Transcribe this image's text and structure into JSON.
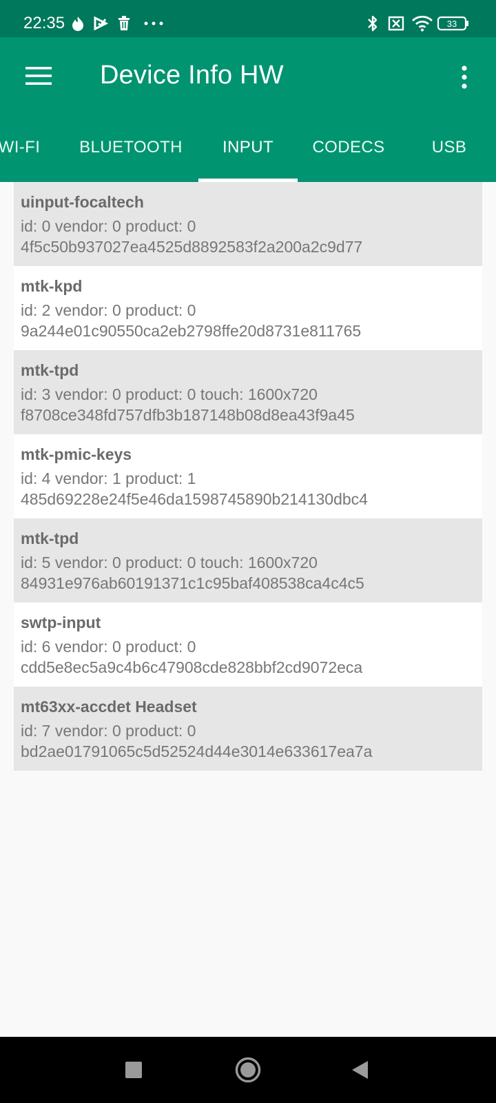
{
  "status_bar": {
    "time": "22:35",
    "battery_level": "33",
    "icons": [
      "fire-icon",
      "play-check-icon",
      "trash-icon",
      "more-dots-icon",
      "bluetooth-icon",
      "no-sim-icon",
      "wifi-icon",
      "battery-icon"
    ]
  },
  "app_bar": {
    "title": "Device Info HW",
    "menu_icon": "hamburger-menu-icon",
    "overflow_icon": "vertical-dots-icon"
  },
  "tabs": [
    {
      "label": "WI-FI"
    },
    {
      "label": "BLUETOOTH"
    },
    {
      "label": "INPUT"
    },
    {
      "label": "CODECS"
    },
    {
      "label": "USB"
    }
  ],
  "active_tab": "INPUT",
  "devices": [
    {
      "name": "uinput-focaltech",
      "detail": "id: 0 vendor: 0 product: 0",
      "hash": "4f5c50b937027ea4525d8892583f2a200a2c9d77"
    },
    {
      "name": "mtk-kpd",
      "detail": "id: 2 vendor: 0 product: 0",
      "hash": "9a244e01c90550ca2eb2798ffe20d8731e811765"
    },
    {
      "name": "mtk-tpd",
      "detail": "id: 3 vendor: 0 product: 0 touch: 1600x720",
      "hash": "f8708ce348fd757dfb3b187148b08d8ea43f9a45"
    },
    {
      "name": "mtk-pmic-keys",
      "detail": "id: 4 vendor: 1 product: 1",
      "hash": "485d69228e24f5e46da1598745890b214130dbc4"
    },
    {
      "name": "mtk-tpd",
      "detail": "id: 5 vendor: 0 product: 0 touch: 1600x720",
      "hash": "84931e976ab60191371c1c95baf408538ca4c4c5"
    },
    {
      "name": "swtp-input",
      "detail": "id: 6 vendor: 0 product: 0",
      "hash": "cdd5e8ec5a9c4b6c47908cde828bbf2cd9072eca"
    },
    {
      "name": "mt63xx-accdet Headset",
      "detail": "id: 7 vendor: 0 product: 0",
      "hash": "bd2ae01791065c5d52524d44e3014e633617ea7a"
    }
  ],
  "nav_bar": {
    "icons": [
      "recents-square-icon",
      "home-circle-icon",
      "back-triangle-icon"
    ]
  },
  "colors": {
    "status_bar": "#00785b",
    "app_bar": "#009470",
    "row_shaded": "#e6e6e6",
    "row_plain": "#ffffff",
    "background": "#f9f9f9"
  }
}
